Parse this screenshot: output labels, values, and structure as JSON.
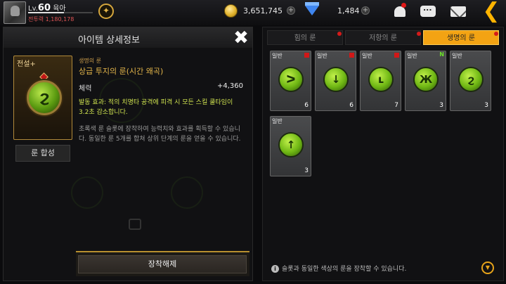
{
  "player": {
    "level_prefix": "Lv.",
    "level": "60",
    "name": "육아",
    "power_label": "전투력",
    "power": "1,180,178",
    "xp_fraction": 0.55
  },
  "currency": {
    "gold": "3,651,745",
    "gems": "1,484"
  },
  "detail": {
    "title": "아이템 상세정보",
    "grade": "전설+",
    "rune_category": "생명의 룬",
    "rune_name": "상급 투지의 룬(시간 왜곡)",
    "stat_name": "체력",
    "stat_value": "+4,360",
    "effect_text": "발동 효과: 적의 치명타 공격에 피격 시 모든 스킬 쿨타임이 3.2초 감소합니다.",
    "description": "초록색 룬 슬롯에 장착하여 능력치와 효과를 획득할 수 있습니다. 동일한 룬 5개를 합쳐 상위 단계의 룬을 얻을 수 있습니다.",
    "synth_label": "룬 합성",
    "unequip_label": "장착해제"
  },
  "tabs": [
    {
      "label": "힘의 룬",
      "active": false,
      "alert": true
    },
    {
      "label": "저항의 룬",
      "active": false,
      "alert": true
    },
    {
      "label": "생명의 룬",
      "active": true,
      "alert": true
    }
  ],
  "runes": [
    {
      "tag": "일반",
      "mark": "red",
      "count": "6",
      "glyph": "ᐳ"
    },
    {
      "tag": "일반",
      "mark": "red",
      "count": "6",
      "glyph": "↓"
    },
    {
      "tag": "일반",
      "mark": "red",
      "count": "7",
      "glyph": "ʟ"
    },
    {
      "tag": "일반",
      "mark": "N",
      "count": "3",
      "glyph": "Ж"
    },
    {
      "tag": "일반",
      "mark": "",
      "count": "3",
      "glyph": "ϩ"
    },
    {
      "tag": "일반",
      "mark": "",
      "count": "3",
      "glyph": "↑"
    }
  ],
  "footer_note": "슬롯과 동일한 색상의 룬을 장착할 수 있습니다.",
  "colors": {
    "accent": "#f3a313",
    "rune_green": "#6fb714",
    "alert": "#e01818"
  },
  "icons": {
    "hint": "lightbulb-icon",
    "gold": "gold-coin-icon",
    "gems": "diamond-icon",
    "bell": "bell-icon",
    "chat": "chat-icon",
    "mail": "mail-icon",
    "back": "back-arrow-icon",
    "close": "close-icon"
  }
}
